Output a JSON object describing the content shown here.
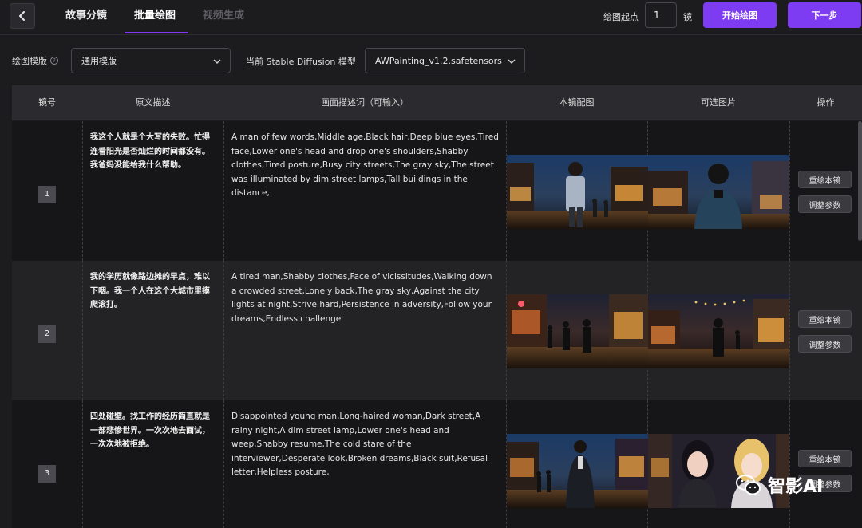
{
  "header": {
    "tabs": [
      {
        "label": "故事分镜",
        "state": "normal"
      },
      {
        "label": "批量绘图",
        "state": "active"
      },
      {
        "label": "视频生成",
        "state": "disabled"
      }
    ],
    "start_label": "绘图起点",
    "start_value": "1",
    "unit_label": "镜",
    "start_button": "开始绘图",
    "next_button": "下一步"
  },
  "settings": {
    "template_label": "绘图模版",
    "template_value": "通用模版",
    "model_label": "当前 Stable Diffusion 模型",
    "model_value": "AWPainting_v1.2.safetensors"
  },
  "table": {
    "columns": [
      "镜号",
      "原文描述",
      "画面描述词（可输入）",
      "本镜配图",
      "可选图片",
      "操作"
    ],
    "rows": [
      {
        "index": "1",
        "original": "我这个人就是个大写的失败。忙得连看阳光是否灿烂的时间都没有。我爸妈没能给我什么帮助。",
        "prompt": "A man of few words,Middle age,Black hair,Deep blue eyes,Tired face,Lower one's head and drop one's shoulders,Shabby clothes,Tired posture,Busy city streets,The gray sky,The street was illuminated by dim street lamps,Tall buildings in the distance,",
        "redraw": "重绘本镜",
        "adjust": "调整参数"
      },
      {
        "index": "2",
        "original": "我的学历就像路边摊的早点，难以下咽。我一个人在这个大城市里摸爬滚打。",
        "prompt": "A tired man,Shabby clothes,Face of vicissitudes,Walking down a crowded street,Lonely back,The gray sky,Against the city lights at night,Strive hard,Persistence in adversity,Follow your dreams,Endless challenge",
        "redraw": "重绘本镜",
        "adjust": "调整参数"
      },
      {
        "index": "3",
        "original": "四处碰壁。找工作的经历简直就是一部悲惨世界。一次次地去面试，一次次地被拒绝。",
        "prompt": "Disappointed young man,Long-haired woman,Dark street,A rainy night,A dim street lamp,Lower one's head and weep,Shabby resume,The cold stare of the interviewer,Desperate look,Broken dreams,Black suit,Refusal letter,Helpless posture,",
        "redraw": "重绘本镜",
        "adjust": "调整参数"
      }
    ]
  },
  "watermark": {
    "text": "智影AI"
  },
  "colors": {
    "accent": "#7d3cf2",
    "background": "#1c1c1f",
    "header_row": "#2b2b2f"
  }
}
